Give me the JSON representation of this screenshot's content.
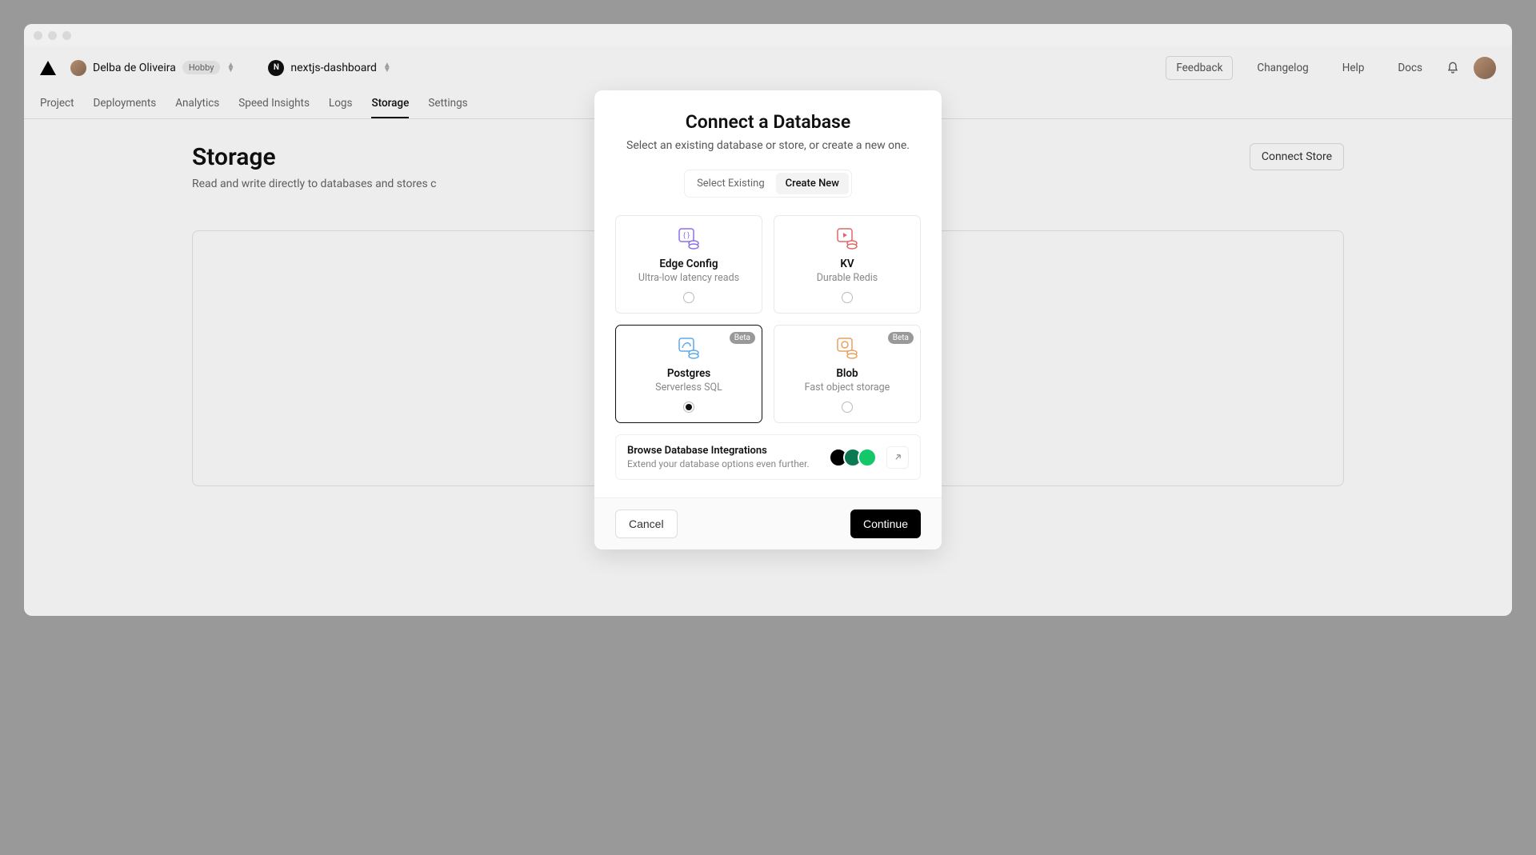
{
  "header": {
    "user_name": "Delba de Oliveira",
    "plan_badge": "Hobby",
    "project_name": "nextjs-dashboard",
    "links": {
      "feedback": "Feedback",
      "changelog": "Changelog",
      "help": "Help",
      "docs": "Docs"
    }
  },
  "tabs": [
    {
      "label": "Project",
      "active": false
    },
    {
      "label": "Deployments",
      "active": false
    },
    {
      "label": "Analytics",
      "active": false
    },
    {
      "label": "Speed Insights",
      "active": false
    },
    {
      "label": "Logs",
      "active": false
    },
    {
      "label": "Storage",
      "active": true
    },
    {
      "label": "Settings",
      "active": false
    }
  ],
  "page": {
    "title": "Storage",
    "subtitle_prefix": "Read and write directly to databases and stores c",
    "connect_button": "Connect Store"
  },
  "modal": {
    "title": "Connect a Database",
    "subtitle": "Select an existing database or store, or create a new one.",
    "segment": {
      "select_existing": "Select Existing",
      "create_new": "Create New",
      "active": "create_new"
    },
    "options": [
      {
        "id": "edge-config",
        "name": "Edge Config",
        "desc": "Ultra-low latency reads",
        "beta": false,
        "selected": false,
        "icon_color": "#8f6fe8"
      },
      {
        "id": "kv",
        "name": "KV",
        "desc": "Durable Redis",
        "beta": false,
        "selected": false,
        "icon_color": "#e06868"
      },
      {
        "id": "postgres",
        "name": "Postgres",
        "desc": "Serverless SQL",
        "beta": true,
        "selected": true,
        "icon_color": "#5fa8e8"
      },
      {
        "id": "blob",
        "name": "Blob",
        "desc": "Fast object storage",
        "beta": true,
        "selected": false,
        "icon_color": "#e8a25f"
      }
    ],
    "beta_label": "Beta",
    "browse": {
      "title": "Browse Database Integrations",
      "subtitle": "Extend your database options even further."
    },
    "buttons": {
      "cancel": "Cancel",
      "continue": "Continue"
    }
  }
}
